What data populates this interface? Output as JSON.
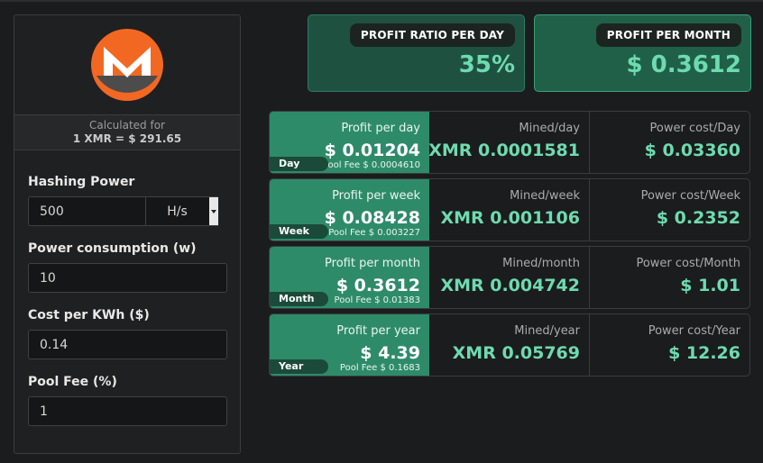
{
  "calculator": {
    "calc_for_label": "Calculated for",
    "rate_text": "1 XMR = $ 291.65",
    "fields": {
      "hashing_power": {
        "label": "Hashing Power",
        "value": "500",
        "unit": "H/s"
      },
      "power_consumption": {
        "label": "Power consumption (w)",
        "value": "10"
      },
      "cost_per_kwh": {
        "label": "Cost per KWh ($)",
        "value": "0.14"
      },
      "pool_fee": {
        "label": "Pool Fee (%)",
        "value": "1"
      }
    }
  },
  "summary": {
    "ratio": {
      "label": "PROFIT RATIO PER DAY",
      "value": "35%"
    },
    "month": {
      "label": "PROFIT PER MONTH",
      "value": "$ 0.3612"
    }
  },
  "rows": [
    {
      "tag": "Day",
      "profit_label": "Profit per day",
      "profit_value": "$ 0.01204",
      "pool_fee": "Pool Fee $ 0.0004610",
      "mined_label": "Mined/day",
      "mined_value": "XMR 0.0001581",
      "power_label": "Power cost/Day",
      "power_value": "$ 0.03360"
    },
    {
      "tag": "Week",
      "profit_label": "Profit per week",
      "profit_value": "$ 0.08428",
      "pool_fee": "Pool Fee $ 0.003227",
      "mined_label": "Mined/week",
      "mined_value": "XMR 0.001106",
      "power_label": "Power cost/Week",
      "power_value": "$ 0.2352"
    },
    {
      "tag": "Month",
      "profit_label": "Profit per month",
      "profit_value": "$ 0.3612",
      "pool_fee": "Pool Fee $ 0.01383",
      "mined_label": "Mined/month",
      "mined_value": "XMR 0.004742",
      "power_label": "Power cost/Month",
      "power_value": "$ 1.01"
    },
    {
      "tag": "Year",
      "profit_label": "Profit per year",
      "profit_value": "$ 4.39",
      "pool_fee": "Pool Fee $ 0.1683",
      "mined_label": "Mined/year",
      "mined_value": "XMR 0.05769",
      "power_label": "Power cost/Year",
      "power_value": "$ 12.26"
    }
  ],
  "colors": {
    "accent_green": "#2e8b6a",
    "value_green": "#6ddbb0",
    "monero_orange": "#f26822",
    "monero_gray": "#4c4c4c"
  },
  "icons": {
    "logo": "monero-logo",
    "dropdown": "caret-down-icon"
  }
}
